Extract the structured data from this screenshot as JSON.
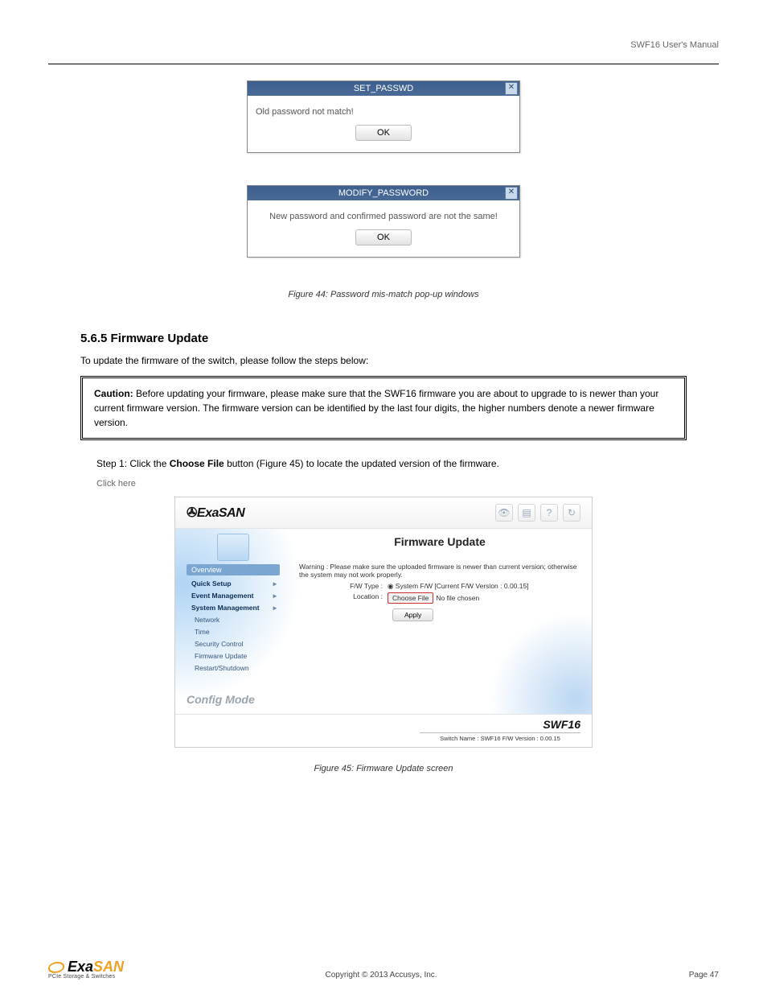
{
  "header": {
    "docTitle": "SWF16 User's Manual"
  },
  "dialog1": {
    "title": "SET_PASSWD",
    "message": "Old password not match!",
    "ok": "OK",
    "close": "✕"
  },
  "dialogCaption1": "Figure 44: Password mis-match pop-up windows",
  "dialog2": {
    "title": "MODIFY_PASSWORD",
    "message": "New password and confirmed password are not the same!",
    "ok": "OK",
    "close": "✕"
  },
  "section": {
    "title": "5.6.5 Firmware Update",
    "text": "To update the firmware of the switch, please follow the steps below:"
  },
  "caution": {
    "label": "Caution:",
    "text": " Before updating your firmware, please make sure that the SWF16 firmware you are about to upgrade to is newer than your current firmware version. The firmware version can be identified by the last four digits, the higher numbers denote a newer firmware version."
  },
  "step1": {
    "text": "Step 1: Click the ",
    "boldA": "Choose File",
    "mid": " button (Figure 45) to locate the updated version of the firmware.",
    "clickHint": "Click here"
  },
  "gui": {
    "logo": "ExaSAN",
    "mainTitle": "Firmware Update",
    "sidebar": {
      "overview": "Overview",
      "items": [
        {
          "label": "Quick Setup",
          "arrow": "▸"
        },
        {
          "label": "Event Management",
          "arrow": "▸"
        },
        {
          "label": "System Management",
          "arrow": "▸"
        },
        {
          "label": "Network",
          "sub": true
        },
        {
          "label": "Time",
          "sub": true
        },
        {
          "label": "Security Control",
          "sub": true
        },
        {
          "label": "Firmware Update",
          "sub": true
        },
        {
          "label": "Restart/Shutdown",
          "sub": true
        }
      ],
      "configMode": "Config Mode"
    },
    "warning": "Warning : Please make sure the uploaded firmware is newer than current version; otherwise the system may not work properly.",
    "fwTypeLabel": "F/W Type :",
    "fwTypeValue": "System F/W [Current F/W Version : 0.00.15]",
    "locationLabel": "Location :",
    "chooseFile": "Choose File",
    "noFile": "No file chosen",
    "apply": "Apply",
    "footerModel": "SWF16",
    "footerStatus": "Switch Name : SWF16  F/W Version : 0.00.15",
    "headerIcons": {
      "eye": "👁",
      "page": "▤",
      "help": "?",
      "refresh": "↻"
    }
  },
  "figCaption": "Figure 45: Firmware Update screen",
  "footer": {
    "logoBlack": "Exa",
    "logoOrange": "SAN",
    "tagline": "PCIe Storage & Switches",
    "center": "Copyright © 2013 Accusys, Inc.",
    "pageLabel": "Page ",
    "pageNum": "47"
  }
}
